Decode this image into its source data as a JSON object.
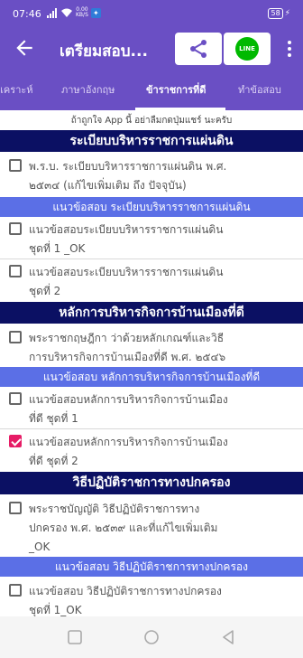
{
  "status": {
    "time": "07:46",
    "speed_top": "0.00",
    "speed_bottom": "KB/S",
    "battery": "58"
  },
  "appbar": {
    "title": "เตรียมสอบ...",
    "line_label": "LINE"
  },
  "tabs": [
    {
      "label": "วิเคราะห์"
    },
    {
      "label": "ภาษาอังกฤษ"
    },
    {
      "label": "ข้าราชการที่ดี"
    },
    {
      "label": "ทำข้อสอบ"
    }
  ],
  "notice": "ถ้าถูกใจ App นี้ อย่าลืมกดปุ่มแชร์ นะครับ",
  "sections": {
    "h1": "ระเบียบบริหารราชการแผ่นดิน",
    "s1": "แนวข้อสอบ ระเบียบบริหารราชการแผ่นดิน",
    "h2": "หลักการบริหารกิจการบ้านเมืองที่ดี",
    "s2": "แนวข้อสอบ หลักการบริหารกิจการบ้านเมืองที่ดี",
    "h3": "วิธีปฏิบัติราชการทางปกครอง",
    "s3": "แนวข้อสอบ วิธีปฏิบัติราชการทางปกครอง"
  },
  "items": [
    {
      "text": "พ.ร.บ. ระเบียบบริหารราชการแผ่นดิน พ.ศ.\n๒๕๓๔ (แก้ไขเพิ่มเติม ถึง ปัจจุบัน)",
      "checked": false
    },
    {
      "text": "แนวข้อสอบระเบียบบริหารราชการแผ่นดิน\nชุดที่ 1 _OK",
      "checked": false
    },
    {
      "text": "แนวข้อสอบระเบียบบริหารราชการแผ่นดิน\nชุดที่ 2",
      "checked": false
    },
    {
      "text": "พระราชกฤษฎีกา ว่าด้วยหลักเกณฑ์และวิธี\nการบริหารกิจการบ้านเมืองที่ดี พ.ศ. ๒๕๔๖",
      "checked": false
    },
    {
      "text": "แนวข้อสอบหลักการบริหารกิจการบ้านเมือง\nที่ดี  ชุดที่ 1",
      "checked": false
    },
    {
      "text": "แนวข้อสอบหลักการบริหารกิจการบ้านเมือง\nที่ดี  ชุดที่ 2",
      "checked": true
    },
    {
      "text": "พระราชบัญญัติ วิธีปฏิบัติราชการทาง\nปกครอง พ.ศ. ๒๕๓๙ และที่แก้ไขเพิ่มเติม\n_OK",
      "checked": false
    },
    {
      "text": "แนวข้อสอบ วิธีปฏิบัติราชการทางปกครอง\nชุดที่ 1_OK",
      "checked": false
    }
  ]
}
